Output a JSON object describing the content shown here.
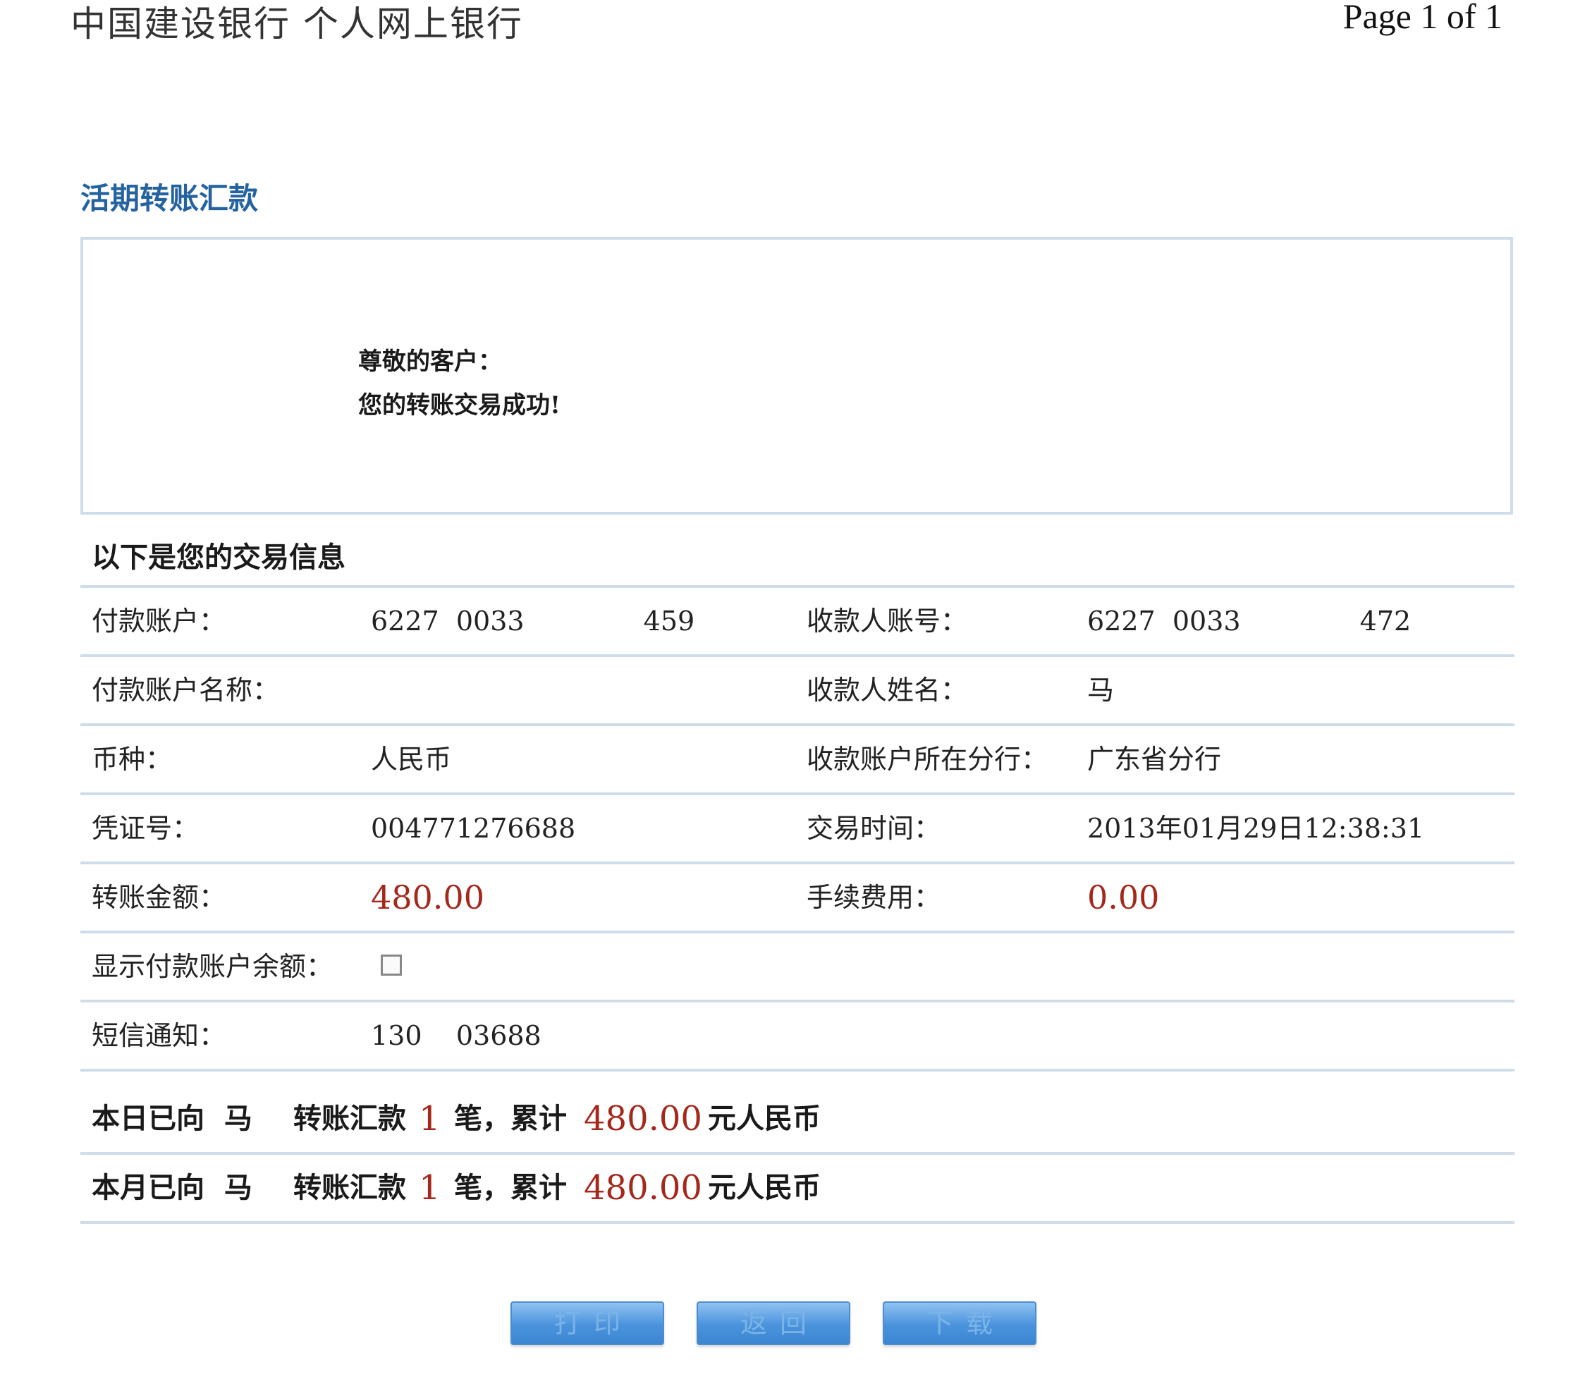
{
  "header": {
    "bank_title": "中国建设银行  个人网上银行",
    "page_indicator": "Page 1 of 1"
  },
  "section_title": "活期转账汇款",
  "message": {
    "greeting": "尊敬的客户：",
    "result": "您的转账交易成功!"
  },
  "info_heading": "以下是您的交易信息",
  "transaction": {
    "payer_account_label": "付款账户：",
    "payer_account_value": "6227  0033              459",
    "payee_account_label": "收款人账号：",
    "payee_account_value": "6227  0033              472",
    "payer_name_label": "付款账户名称：",
    "payer_name_value": "",
    "payee_name_label": "收款人姓名：",
    "payee_name_value": "马",
    "currency_label": "币种：",
    "currency_value": "人民币",
    "payee_branch_label": "收款账户所在分行：",
    "payee_branch_value": "广东省分行",
    "voucher_label": "凭证号：",
    "voucher_value": "004771276688",
    "time_label": "交易时间：",
    "time_value": "2013年01月29日12:38:31",
    "amount_label": "转账金额：",
    "amount_value": "480.00",
    "fee_label": "手续费用：",
    "fee_value": "0.00",
    "show_balance_label": "显示付款账户余额：",
    "show_balance_checked": false,
    "sms_label": "短信通知：",
    "sms_value": "130    03688"
  },
  "summary": {
    "daily": {
      "prefix": "本日已向  马  ",
      "mid": "转账汇款",
      "count": "1",
      "count_suffix": "笔，累计",
      "total": "480.00",
      "unit": "元人民币"
    },
    "monthly": {
      "prefix": "本月已向  马  ",
      "mid": "转账汇款",
      "count": "1",
      "count_suffix": "笔，累计",
      "total": "480.00",
      "unit": "元人民币"
    }
  },
  "buttons": {
    "print": "打印",
    "back": "返回",
    "download": "下载"
  },
  "colors": {
    "section_title": "#2563a0",
    "amount_red": "#a4281c",
    "border": "#cfdcea",
    "button": "#4a93dc"
  }
}
